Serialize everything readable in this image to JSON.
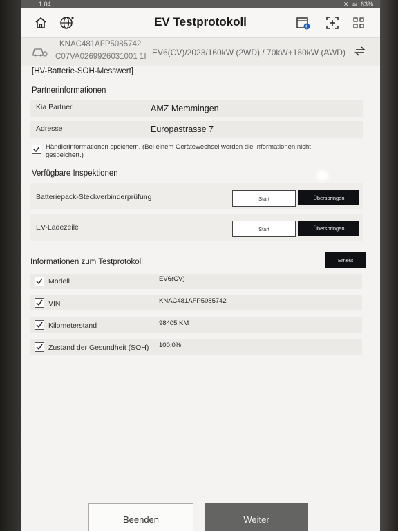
{
  "status": {
    "time": "1:04",
    "battery": "63%"
  },
  "header": {
    "title": "EV Testprotokoll"
  },
  "vehicle": {
    "vin": "KNAC481AFP5085742",
    "code": "C07VA0269926031001 1I",
    "spec": "EV6(CV)/2023/160kW (2WD) / 70kW+160kW (AWD)"
  },
  "page": {
    "heading": "[HV-Batterie-SOH-Messwert]"
  },
  "partner": {
    "title": "Partnerinformationen",
    "rows": [
      {
        "label": "Kia Partner",
        "value": "AMZ Memmingen"
      },
      {
        "label": "Adresse",
        "value": "Europastrasse 7"
      }
    ],
    "save_checkbox_label": "Händlerinformationen speichern. (Bei einem Gerätewechsel werden die Informationen nicht gespeichert.)"
  },
  "inspections": {
    "title": "Verfügbare Inspektionen",
    "items": [
      {
        "label": "Batteriepack-Steckverbinderprüfung",
        "start": "Start",
        "skip": "Überspringen"
      },
      {
        "label": "EV-Ladezeile",
        "start": "Start",
        "skip": "Überspringen"
      }
    ]
  },
  "protocol": {
    "title": "Informationen zum Testprotokoll",
    "retry_label": "Erneut",
    "rows": [
      {
        "label": "Modell",
        "value": "EV6(CV)"
      },
      {
        "label": "VIN",
        "value": "KNAC481AFP5085742"
      },
      {
        "label": "Kilometerstand",
        "value": "98405 KM"
      },
      {
        "label": "Zustand der Gesundheit (SOH)",
        "value": "100.0%"
      }
    ]
  },
  "footer": {
    "finish_label": "Beenden",
    "next_label": "Weiter"
  }
}
